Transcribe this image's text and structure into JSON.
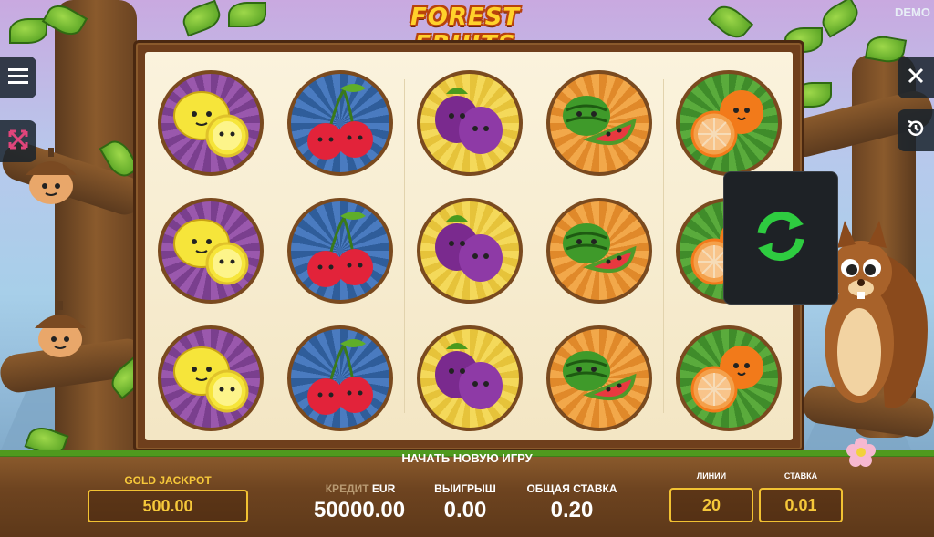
{
  "header": {
    "title": "FOREST FRUITS",
    "mode_badge": "DEMO"
  },
  "reels": [
    [
      "lemon",
      "cherry",
      "plum",
      "watermelon",
      "orange"
    ],
    [
      "lemon",
      "cherry",
      "plum",
      "watermelon",
      "orange"
    ],
    [
      "lemon",
      "cherry",
      "plum",
      "watermelon",
      "orange"
    ]
  ],
  "controls": {
    "menu_icon": "hamburger-menu-icon",
    "expand_icon": "expand-arrows-icon",
    "close_icon": "close-icon",
    "history_icon": "history-icon",
    "spin_icon": "refresh-arrows-icon"
  },
  "bottom": {
    "new_game_label": "НАЧАТЬ НОВУЮ ИГРУ",
    "jackpot_label": "GOLD JACKPOT",
    "jackpot_value": "500.00",
    "credit_label": "КРЕДИТ",
    "credit_currency": "EUR",
    "credit_value": "50000.00",
    "win_label": "ВЫИГРЫШ",
    "win_value": "0.00",
    "total_bet_label": "ОБЩАЯ СТАВКА",
    "total_bet_value": "0.20",
    "lines_label": "ЛИНИИ",
    "lines_value": "20",
    "bet_label": "СТАВКА",
    "bet_value": "0.01"
  },
  "colors": {
    "accent_gold": "#f2c232",
    "spin_green": "#2ecc40",
    "panel_brown": "#6e4420"
  }
}
